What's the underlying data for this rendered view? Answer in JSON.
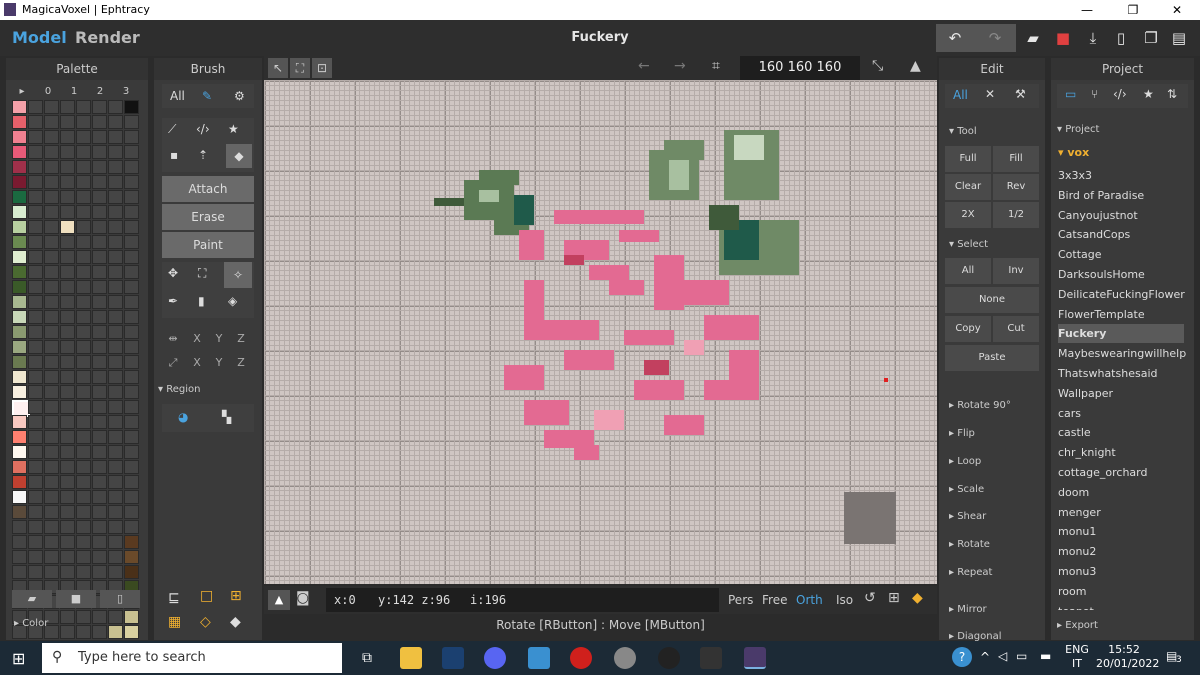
{
  "window": {
    "title": "MagicaVoxel | Ephtracy",
    "min": "—",
    "max": "❐",
    "close": "✕"
  },
  "header": {
    "tab_model": "Model",
    "tab_render": "Render",
    "project_title": "Fuckery",
    "accent": "#4aa3df"
  },
  "palette": {
    "title": "Palette",
    "col_headers": [
      "▸",
      "0",
      "1",
      "2",
      "3"
    ],
    "footer_label": "Color",
    "selected_color": "#ff7060"
  },
  "brush": {
    "title": "Brush",
    "mode_all": "All",
    "attach": "Attach",
    "erase": "Erase",
    "paint": "Paint",
    "axis_x": "X",
    "axis_y": "Y",
    "axis_z": "Z",
    "region": "Region"
  },
  "viewport": {
    "dims": "160  160  160",
    "status_x": "x:0",
    "status_yz": "y:142 z:96",
    "status_i": "i:196",
    "view_pers": "Pers",
    "view_free": "Free",
    "view_orth": "Orth",
    "view_iso": "Iso",
    "hint": "Rotate [RButton] : Move [MButton]"
  },
  "edit": {
    "title": "Edit",
    "mode_all": "All",
    "tool": "Tool",
    "full": "Full",
    "fill": "Fill",
    "clear": "Clear",
    "rev": "Rev",
    "x2": "2X",
    "half": "1/2",
    "select": "Select",
    "sel_all": "All",
    "sel_inv": "Inv",
    "sel_none": "None",
    "copy": "Copy",
    "cut": "Cut",
    "paste": "Paste",
    "rotate90": "Rotate 90°",
    "flip": "Flip",
    "loop": "Loop",
    "scale": "Scale",
    "shear": "Shear",
    "rotate": "Rotate",
    "repeat": "Repeat",
    "mirror": "Mirror",
    "diagonal": "Diagonal"
  },
  "project": {
    "title": "Project",
    "header": "Project",
    "folder": "vox",
    "items": [
      "3x3x3",
      "Bird of Paradise",
      "Canyoujustnot",
      "CatsandCops",
      "Cottage",
      "DarksoulsHome",
      "DeilicateFuckingFlower",
      "FlowerTemplate",
      "Fuckery",
      "Maybeswearingwillhelp",
      "Thatswhatshesaid",
      "Wallpaper",
      "cars",
      "castle",
      "chr_knight",
      "cottage_orchard",
      "doom",
      "menger",
      "monu1",
      "monu2",
      "monu3",
      "room",
      "teapot"
    ],
    "selected": "Fuckery",
    "export": "Export"
  },
  "taskbar": {
    "search_placeholder": "Type here to search",
    "lang_top": "ENG",
    "lang_bottom": "IT",
    "time": "15:52",
    "date": "20/01/2022",
    "notif_count": "3"
  }
}
